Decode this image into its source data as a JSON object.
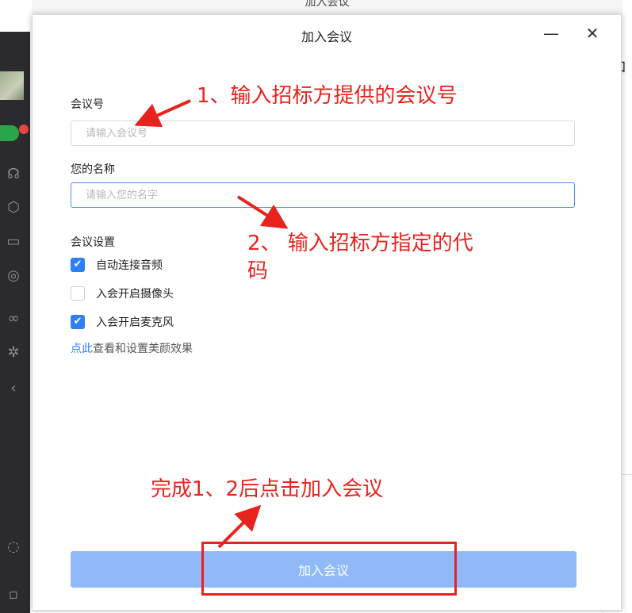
{
  "background": {
    "top_window_title": "加入会议",
    "right_panel_char": "加"
  },
  "dialog": {
    "title": "加入会议",
    "minimize_glyph": "—",
    "close_glyph": "✕",
    "meeting_id": {
      "label": "会议号",
      "placeholder": "请输入会议号",
      "value": ""
    },
    "name": {
      "label": "您的名称",
      "placeholder": "请输入您的名字",
      "value": ""
    },
    "settings": {
      "label": "会议设置",
      "options": [
        {
          "label": "自动连接音频",
          "checked": true
        },
        {
          "label": "入会开启摄像头",
          "checked": false
        },
        {
          "label": "入会开启麦克风",
          "checked": true
        }
      ]
    },
    "beauty": {
      "link_text": "点此",
      "rest_text": "查看和设置美颜效果"
    },
    "join_button": "加入会议"
  },
  "annotations": {
    "step1": "1、输入招标方提供的会议号",
    "step2_line1": "2、 输入招标方指定的代",
    "step2_line2": "码",
    "step3": "完成1、2后点击加入会议",
    "color": "#e8231e"
  },
  "colors": {
    "accent": "#2d7ff5",
    "join_button_bg": "#8fbaf7",
    "annotation_red": "#e8231e"
  }
}
